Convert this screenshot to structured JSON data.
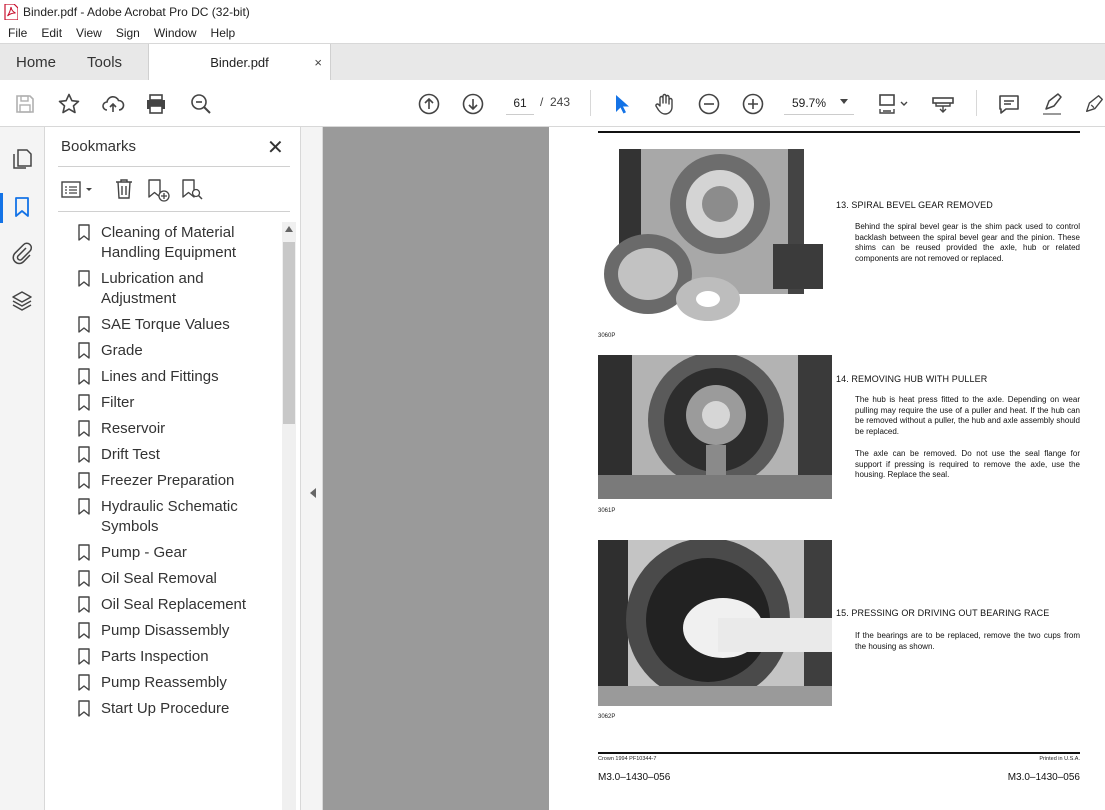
{
  "window": {
    "title": "Binder.pdf - Adobe Acrobat Pro DC (32-bit)"
  },
  "menu": [
    "File",
    "Edit",
    "View",
    "Sign",
    "Window",
    "Help"
  ],
  "tabs": {
    "home": "Home",
    "tools": "Tools",
    "document": "Binder.pdf",
    "close_glyph": "×"
  },
  "toolbar": {
    "current_page": "61",
    "page_separator": "/",
    "total_pages": "243",
    "zoom": "59.7%"
  },
  "bookmarks": {
    "title": "Bookmarks",
    "close_glyph": "✕",
    "items": [
      "Cleaning of Material Handling Equipment",
      "Lubrication and Adjustment",
      "SAE Torque Values",
      "Grade",
      "Lines and Fittings",
      "Filter",
      "Reservoir",
      "Drift Test",
      "Freezer Preparation",
      "Hydraulic Schematic Symbols",
      "Pump - Gear",
      "Oil Seal Removal",
      "Oil Seal Replacement",
      "Pump Disassembly",
      "Parts Inspection",
      "Pump Reassembly",
      "Start Up Procedure"
    ]
  },
  "page": {
    "steps": [
      {
        "title": "13.  SPIRAL BEVEL GEAR REMOVED",
        "body": "Behind the spiral bevel gear is the shim pack used to control backlash between the spiral bevel gear and the pinion. These shims can be reused provided the axle, hub or related components are not removed or replaced.",
        "photo_label": "3060P"
      },
      {
        "title": "14.  REMOVING HUB WITH PULLER",
        "body": "The hub is heat press fitted to the axle.  Depending on wear pulling may require the use of a puller and heat.  If the hub can be removed without a puller, the hub and axle assembly should be replaced.",
        "body2": "The axle can be removed.  Do not use the seal flange for support if pressing is required to remove the axle, use the housing. Replace the seal.",
        "photo_label": "3061P"
      },
      {
        "title": "15.  PRESSING OR DRIVING OUT BEARING RACE",
        "body": "If the bearings are to be replaced, remove the two cups from the housing as shown.",
        "photo_label": "3062P"
      }
    ],
    "footer_left_small": "Crown 1994 PF10344-7",
    "footer_right_small": "Printed in U.S.A.",
    "footer_left_code": "M3.0–1430–056",
    "footer_right_code": "M3.0–1430–056"
  },
  "colors": {
    "accent": "#1473e6",
    "doc_background": "#9a9a9a",
    "tab_bar": "#e8e8e8"
  }
}
